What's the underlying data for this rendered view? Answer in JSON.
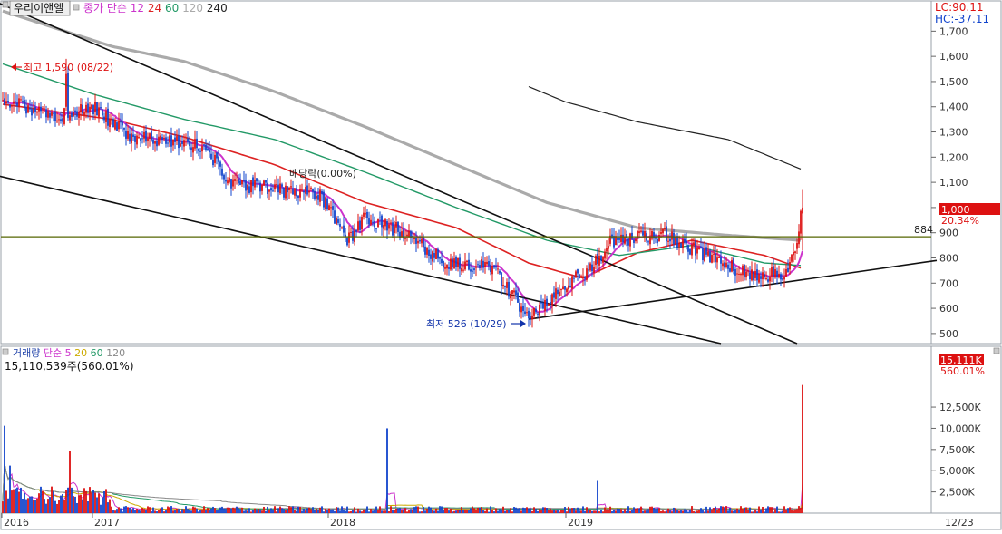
{
  "title_bar": {
    "stock_name": "우리이앤엘",
    "price_legend": [
      {
        "text": "종가 단순",
        "color": "#cc33cc"
      },
      {
        "text": "12",
        "color": "#cc33cc"
      },
      {
        "text": "24",
        "color": "#dd2222"
      },
      {
        "text": "60",
        "color": "#229966"
      },
      {
        "text": "120",
        "color": "#aaaaaa"
      },
      {
        "text": "240",
        "color": "#222222"
      }
    ],
    "lc_label": "LC:90.11",
    "hc_label": "HC:-37.11"
  },
  "annotations": {
    "high_label": "최고 1,590 (08/22)",
    "low_label": "최저 526 (10/29)",
    "dividend_label": "배당락(0.00%)",
    "level_label": "884",
    "current_price": "1,000",
    "current_change": "20.34%"
  },
  "volume_panel": {
    "legend": [
      {
        "text": "거래량",
        "color": "#2244aa"
      },
      {
        "text": "단순 5",
        "color": "#cc33cc"
      },
      {
        "text": "20",
        "color": "#ccaa00"
      },
      {
        "text": "60",
        "color": "#229966"
      },
      {
        "text": "120",
        "color": "#888888"
      }
    ],
    "info": "15,110,539주(560.01%)",
    "current_volume": "15,111K",
    "current_ratio": "560.01%"
  },
  "colors": {
    "up": "#dd1111",
    "down": "#1144cc",
    "ma12": "#cc33cc",
    "ma24": "#dd2222",
    "ma60": "#229966",
    "ma120": "#aaaaaa",
    "ma240": "#222222",
    "level": "#556600"
  },
  "chart_data": [
    {
      "type": "candlestick",
      "title": "우리이앤엘",
      "x_ticks": [
        "2016",
        "2017",
        "2018",
        "2019",
        "12/23"
      ],
      "y_ticks": [
        "1,700",
        "1,600",
        "1,500",
        "1,400",
        "1,300",
        "1,200",
        "1,100",
        "1,000",
        "900",
        "800",
        "700",
        "600",
        "500"
      ],
      "ylim": [
        460,
        1820
      ],
      "series_close_waypoints": [
        {
          "t": 0,
          "v": 1440
        },
        {
          "t": 10,
          "v": 1400
        },
        {
          "t": 30,
          "v": 1360
        },
        {
          "t": 50,
          "v": 1400
        },
        {
          "t": 70,
          "v": 1280
        },
        {
          "t": 90,
          "v": 1260
        },
        {
          "t": 110,
          "v": 1250
        },
        {
          "t": 125,
          "v": 1100
        },
        {
          "t": 150,
          "v": 1070
        },
        {
          "t": 175,
          "v": 1050
        },
        {
          "t": 190,
          "v": 870
        },
        {
          "t": 200,
          "v": 960
        },
        {
          "t": 225,
          "v": 890
        },
        {
          "t": 245,
          "v": 770
        },
        {
          "t": 270,
          "v": 770
        },
        {
          "t": 290,
          "v": 560
        },
        {
          "t": 310,
          "v": 700
        },
        {
          "t": 325,
          "v": 760
        },
        {
          "t": 335,
          "v": 860
        },
        {
          "t": 350,
          "v": 880
        },
        {
          "t": 365,
          "v": 890
        },
        {
          "t": 385,
          "v": 820
        },
        {
          "t": 410,
          "v": 740
        },
        {
          "t": 430,
          "v": 730
        },
        {
          "t": 438,
          "v": 830
        },
        {
          "t": 440,
          "v": 1000
        }
      ],
      "moving_averages": {
        "ma24": [
          {
            "t": 0,
            "v": 1410
          },
          {
            "t": 60,
            "v": 1350
          },
          {
            "t": 100,
            "v": 1280
          },
          {
            "t": 150,
            "v": 1170
          },
          {
            "t": 200,
            "v": 1020
          },
          {
            "t": 250,
            "v": 920
          },
          {
            "t": 290,
            "v": 780
          },
          {
            "t": 320,
            "v": 720
          },
          {
            "t": 350,
            "v": 820
          },
          {
            "t": 380,
            "v": 870
          },
          {
            "t": 420,
            "v": 810
          },
          {
            "t": 440,
            "v": 760
          }
        ],
        "ma60": [
          {
            "t": 0,
            "v": 1570
          },
          {
            "t": 50,
            "v": 1450
          },
          {
            "t": 100,
            "v": 1350
          },
          {
            "t": 150,
            "v": 1270
          },
          {
            "t": 200,
            "v": 1140
          },
          {
            "t": 250,
            "v": 1000
          },
          {
            "t": 300,
            "v": 870
          },
          {
            "t": 340,
            "v": 810
          },
          {
            "t": 380,
            "v": 850
          },
          {
            "t": 420,
            "v": 780
          },
          {
            "t": 440,
            "v": 770
          }
        ],
        "ma120": [
          {
            "t": 0,
            "v": 1780
          },
          {
            "t": 60,
            "v": 1640
          },
          {
            "t": 100,
            "v": 1580
          },
          {
            "t": 150,
            "v": 1460
          },
          {
            "t": 200,
            "v": 1320
          },
          {
            "t": 250,
            "v": 1170
          },
          {
            "t": 300,
            "v": 1020
          },
          {
            "t": 350,
            "v": 920
          },
          {
            "t": 400,
            "v": 890
          },
          {
            "t": 440,
            "v": 870
          }
        ],
        "ma240": [
          {
            "t": 290,
            "v": 1480
          },
          {
            "t": 310,
            "v": 1420
          },
          {
            "t": 350,
            "v": 1340
          },
          {
            "t": 400,
            "v": 1270
          },
          {
            "t": 441,
            "v": 1150
          }
        ]
      },
      "trendlines": [
        {
          "from": {
            "t": -5,
            "v": 1820
          },
          "to": {
            "t": 438,
            "v": 460
          }
        },
        {
          "from": {
            "t": -5,
            "v": 1130
          },
          "to": {
            "t": 396,
            "v": 460
          }
        },
        {
          "from": {
            "t": 290,
            "v": 557
          },
          "to": {
            "t": 515,
            "v": 790
          }
        }
      ],
      "horizontal_level": 884,
      "high": {
        "value": 1590,
        "date": "08/22"
      },
      "low": {
        "value": 526,
        "date": "10/29"
      }
    },
    {
      "type": "bar",
      "title": "거래량",
      "y_ticks": [
        "12,500K",
        "10,000K",
        "7,500K",
        "5,000K",
        "2,500K"
      ],
      "ylim": [
        0,
        15500
      ],
      "unit": "K",
      "spikes": [
        {
          "t": 1,
          "v": 10300
        },
        {
          "t": 4,
          "v": 5600
        },
        {
          "t": 37,
          "v": 7300
        },
        {
          "t": 212,
          "v": 10000
        },
        {
          "t": 328,
          "v": 3900
        },
        {
          "t": 441,
          "v": 15111
        }
      ]
    }
  ]
}
